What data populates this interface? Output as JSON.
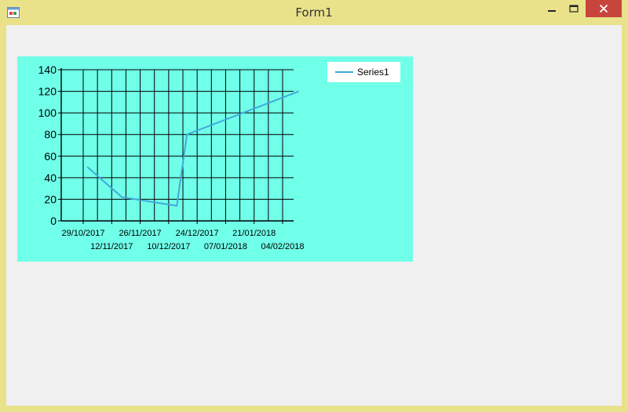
{
  "window": {
    "title": "Form1",
    "icons": {
      "app": "windows-form-icon",
      "minimize": "minimize-icon",
      "maximize": "maximize-icon",
      "close": "close-icon"
    },
    "colors": {
      "frame": "#e9e28b",
      "client": "#f0f0f0",
      "close": "#c8453d",
      "chart_bg": "#70ffe9",
      "series": "#41a9d9"
    }
  },
  "chart_data": {
    "type": "line",
    "x": [
      "29/10/2017",
      "12/11/2017",
      "26/11/2017",
      "10/12/2017",
      "24/12/2017",
      "07/01/2018",
      "21/01/2018",
      "04/02/2018"
    ],
    "x_tick_labels": [
      "29/10/2017",
      "12/11/2017",
      "26/11/2017",
      "10/12/2017",
      "24/12/2017",
      "07/01/2018",
      "21/01/2018",
      "04/02/2018"
    ],
    "y_tick_labels": [
      "0",
      "20",
      "40",
      "60",
      "80",
      "100",
      "120",
      "140"
    ],
    "ylim": [
      0,
      140
    ],
    "grid": true,
    "legend_position": "top-right",
    "series": [
      {
        "name": "Series1",
        "points": [
          {
            "x": "31/10/2017",
            "y": 50
          },
          {
            "x": "17/11/2017",
            "y": 22
          },
          {
            "x": "14/12/2017",
            "y": 14
          },
          {
            "x": "19/12/2017",
            "y": 80
          },
          {
            "x": "12/02/2018",
            "y": 120
          }
        ]
      }
    ]
  }
}
